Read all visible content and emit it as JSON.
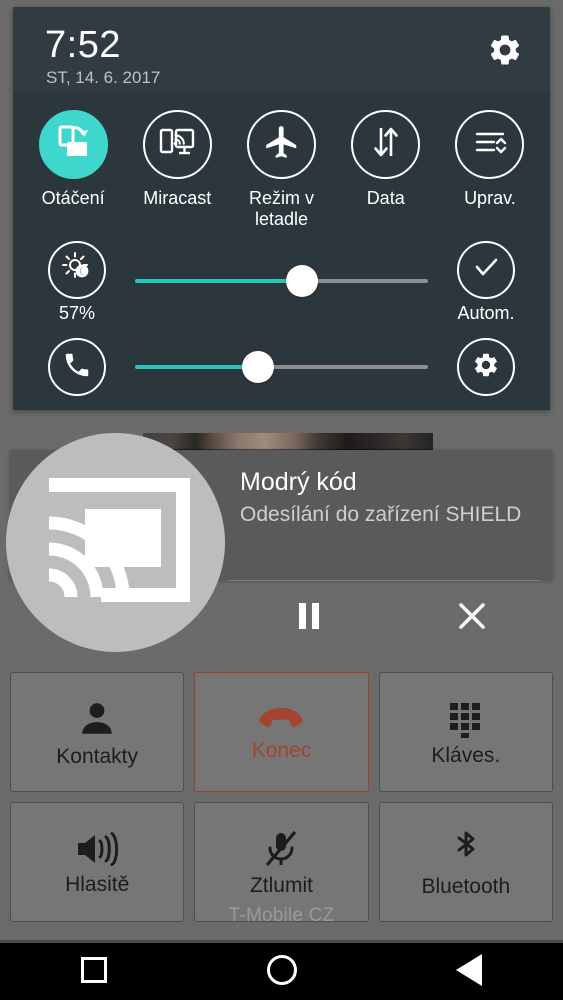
{
  "quick_settings": {
    "time": "7:52",
    "date": "ST, 14. 6. 2017",
    "settings_icon": "gear-icon",
    "toggles": [
      {
        "label": "Otáčení",
        "icon": "screen-rotation-icon",
        "active": true
      },
      {
        "label": "Miracast",
        "icon": "cast-screen-icon",
        "active": false
      },
      {
        "label": "Režim v letadle",
        "icon": "airplane-icon",
        "active": false
      },
      {
        "label": "Data",
        "icon": "data-transfer-arrows-icon",
        "active": false
      },
      {
        "label": "Uprav.",
        "icon": "tune-sliders-icon",
        "active": false
      }
    ],
    "brightness": {
      "icon": "brightness-auto-icon",
      "value_label": "57%",
      "percent": 57,
      "auto_label": "Autom.",
      "auto_icon": "check-icon"
    },
    "volume": {
      "icon": "phone-call-icon",
      "percent": 42,
      "settings_icon": "gear-icon"
    }
  },
  "notification": {
    "icon": "cast-icon",
    "title": "Modrý kód",
    "subtitle": "Odesílání do zařízení SHIELD",
    "actions": [
      {
        "name": "pause-button",
        "icon": "pause-icon"
      },
      {
        "name": "close-button",
        "icon": "close-icon"
      }
    ]
  },
  "in_call": {
    "carrier": "T-Mobile CZ",
    "buttons": [
      [
        {
          "label": "Kontakty",
          "icon": "contact-person-icon",
          "style": "normal"
        },
        {
          "label": "Konec",
          "icon": "end-call-icon",
          "style": "end"
        },
        {
          "label": "Kláves.",
          "icon": "dialpad-icon",
          "style": "normal"
        }
      ],
      [
        {
          "label": "Hlasitě",
          "icon": "speaker-icon",
          "style": "normal"
        },
        {
          "label": "Ztlumit",
          "icon": "mic-off-icon",
          "style": "normal"
        },
        {
          "label": "Bluetooth",
          "icon": "bluetooth-icon",
          "style": "normal"
        }
      ]
    ]
  },
  "navbar": {
    "recents": "recents-square-icon",
    "home": "home-circle-icon",
    "back": "back-triangle-icon"
  },
  "colors": {
    "accent_teal": "#3ed6cd",
    "slider_teal": "#1ec8bd",
    "panel_bg": "#2c373d",
    "notification_bg": "#5a5a5a",
    "end_call_red": "#a4432f"
  }
}
